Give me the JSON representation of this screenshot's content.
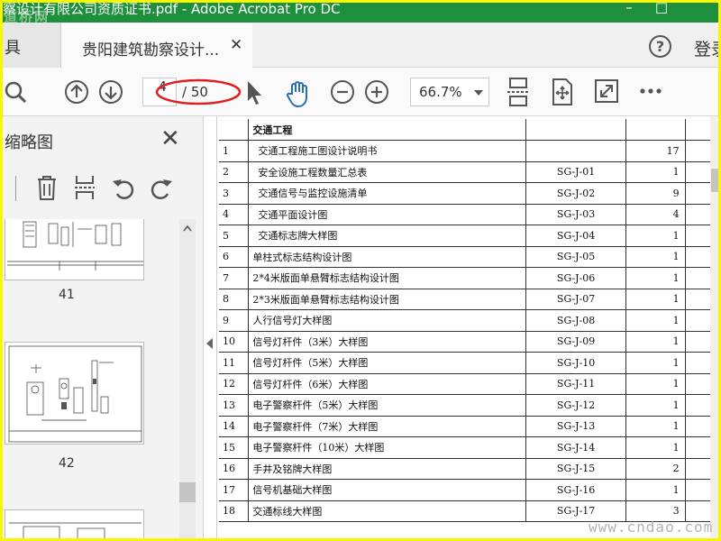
{
  "window": {
    "title": "察设计有限公司资质证书.pdf - Adobe Acrobat Pro DC",
    "watermark": "道桥网",
    "minimize_glyph": "–",
    "maximize_glyph": "□"
  },
  "tabs": {
    "tools_label": "具",
    "document_label": "贵阳建筑勘察设计...",
    "close_glyph": "✕",
    "help_glyph": "?",
    "login_label": "登录"
  },
  "toolbar": {
    "page_current": "4",
    "page_total": "/ 50",
    "zoom": "66.7%",
    "icons": [
      "search-icon",
      "page-up-icon",
      "page-down-icon",
      "select-arrow-icon",
      "hand-icon",
      "zoom-out-icon",
      "zoom-in-icon",
      "scroll-mode-icon",
      "fit-page-icon",
      "full-screen-icon",
      "more-icon"
    ],
    "annotation_color": "#e02020"
  },
  "sidebar": {
    "title": "缩略图",
    "close_glyph": "✕",
    "tools": [
      "options-icon",
      "delete-icon",
      "insert-pages-icon",
      "undo-icon",
      "redo-icon"
    ],
    "thumbnails": [
      {
        "label": "41"
      },
      {
        "label": "42"
      }
    ]
  },
  "document": {
    "header_title": "交通工程",
    "rows": [
      {
        "no": "1",
        "name": "交通工程施工图设计说明书",
        "code": "",
        "count": "17",
        "indent": true
      },
      {
        "no": "2",
        "name": "安全设施工程数量汇总表",
        "code": "SG-J-01",
        "count": "1",
        "indent": true
      },
      {
        "no": "3",
        "name": "交通信号与监控设施清单",
        "code": "SG-J-02",
        "count": "9",
        "indent": true
      },
      {
        "no": "4",
        "name": "交通平面设计图",
        "code": "SG-J-03",
        "count": "4",
        "indent": true
      },
      {
        "no": "5",
        "name": "交通标志牌大样图",
        "code": "SG-J-04",
        "count": "1",
        "indent": true
      },
      {
        "no": "6",
        "name": "单柱式标志结构设计图",
        "code": "SG-J-05",
        "count": "1",
        "indent": false
      },
      {
        "no": "7",
        "name": "2*4米版面单悬臂标志结构设计图",
        "code": "SG-J-06",
        "count": "1",
        "indent": false
      },
      {
        "no": "8",
        "name": "2*3米版面单悬臂标志结构设计图",
        "code": "SG-J-07",
        "count": "1",
        "indent": false
      },
      {
        "no": "9",
        "name": "人行信号灯大样图",
        "code": "SG-J-08",
        "count": "1",
        "indent": false
      },
      {
        "no": "10",
        "name": "信号灯杆件（3米）大样图",
        "code": "SG-J-09",
        "count": "1",
        "indent": false
      },
      {
        "no": "11",
        "name": "信号灯杆件（5米）大样图",
        "code": "SG-J-10",
        "count": "1",
        "indent": false
      },
      {
        "no": "12",
        "name": "信号灯杆件（6米）大样图",
        "code": "SG-J-11",
        "count": "1",
        "indent": false
      },
      {
        "no": "13",
        "name": "电子警察杆件（5米）大样图",
        "code": "SG-J-12",
        "count": "1",
        "indent": false
      },
      {
        "no": "14",
        "name": "电子警察杆件（7米）大样图",
        "code": "SG-J-13",
        "count": "1",
        "indent": false
      },
      {
        "no": "15",
        "name": "电子警察杆件（10米）大样图",
        "code": "SG-J-14",
        "count": "1",
        "indent": false
      },
      {
        "no": "16",
        "name": "手井及铭牌大样图",
        "code": "SG-J-15",
        "count": "2",
        "indent": false
      },
      {
        "no": "17",
        "name": "信号机基础大样图",
        "code": "SG-J-16",
        "count": "1",
        "indent": false
      },
      {
        "no": "18",
        "name": "交通标线大样图",
        "code": "SG-J-17",
        "count": "3",
        "indent": false
      }
    ]
  },
  "site_watermark": "www.cndao.com",
  "colors": {
    "title_bar": "#1e8f3c",
    "outer_border": "#f7f700",
    "accent_blue": "#2a6ebb"
  }
}
